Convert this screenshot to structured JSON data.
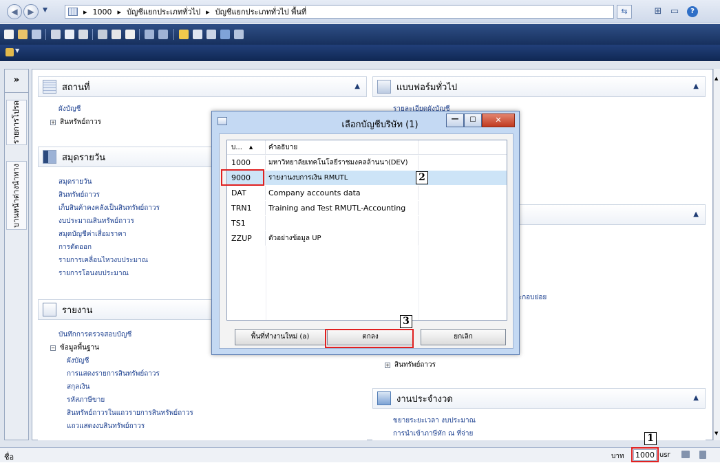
{
  "address": {
    "crumbs": [
      "1000",
      "บัญชีแยกประเภททั่วไป",
      "บัญชีแยกประเภททั่วไป พื้นที่"
    ]
  },
  "navstrip": {
    "collapse": "»",
    "tab1": "รายการโปรด",
    "tab2": "บานหน้าต่างนำทาง"
  },
  "panels": {
    "places": {
      "title": "สถานที่",
      "items": [
        "ผังบัญชี",
        "สินทรัพย์ถาวร"
      ]
    },
    "journals": {
      "title": "สมุดรายวัน",
      "items": [
        "สมุดรายวัน",
        "สินทรัพย์ถาวร",
        "เก็บสินค้าคงคลังเป็นสินทรัพย์ถาวร",
        "งบประมาณสินทรัพย์ถาวร",
        "สมุดบัญชีค่าเสื่อมราคา",
        "การตัดออก",
        "รายการเคลื่อนไหวงบประมาณ",
        "รายการโอนงบประมาณ"
      ]
    },
    "reports": {
      "title": "รายงาน",
      "items": [
        "บันทึกการตรวจสอบบัญชี",
        "ข้อมูลพื้นฐาน",
        "ผังบัญชี",
        "การแสดงรายการสินทรัพย์ถาวร",
        "สกุลเงิน",
        "รหัสภาษีขาย",
        "สินทรัพย์ถาวรในแถวรายการสินทรัพย์ถาวร",
        "แถวแสดงงบสินทรัพย์ถาวร"
      ]
    },
    "forms": {
      "title": "แบบฟอร์มทั่วไป",
      "item": "รายละเอียดผังบัญชี"
    },
    "right_mid": {
      "fragment": "ประกอบย่อย",
      "expand_item": "สินทรัพย์ถาวร"
    },
    "periodic": {
      "title": "งานประจำงวด",
      "items": [
        "ขยายระยะเวลา งบประมาณ",
        "การนำเข้าภาษีหัก ณ ที่จ่าย"
      ]
    }
  },
  "dialog": {
    "title": "เลือกบัญชีบริษัท (1)",
    "col1": "บ...",
    "col2": "คำอธิบาย",
    "rows": [
      {
        "code": "1000",
        "desc": "มหาวิทยาลัยเทคโนโลยีราชมงคลล้านนา(DEV)"
      },
      {
        "code": "9000",
        "desc": "รายงานงบการเงิน RMUTL"
      },
      {
        "code": "DAT",
        "desc": "Company accounts data"
      },
      {
        "code": "TRN1",
        "desc": "Training and Test RMUTL-Accounting"
      },
      {
        "code": "TS1",
        "desc": ""
      },
      {
        "code": "ZZUP",
        "desc": "ตัวอย่างข้อมูล UP"
      }
    ],
    "btn_new": "พื้นที่ทำงานใหม่ (a)",
    "btn_ok": "ตกลง",
    "btn_cancel": "ยกเลิก"
  },
  "callouts": {
    "c1": "1",
    "c2": "2",
    "c3": "3"
  },
  "status": {
    "left": "ชื่อ",
    "currency": "บาท",
    "company": "1000",
    "user": "usr"
  }
}
